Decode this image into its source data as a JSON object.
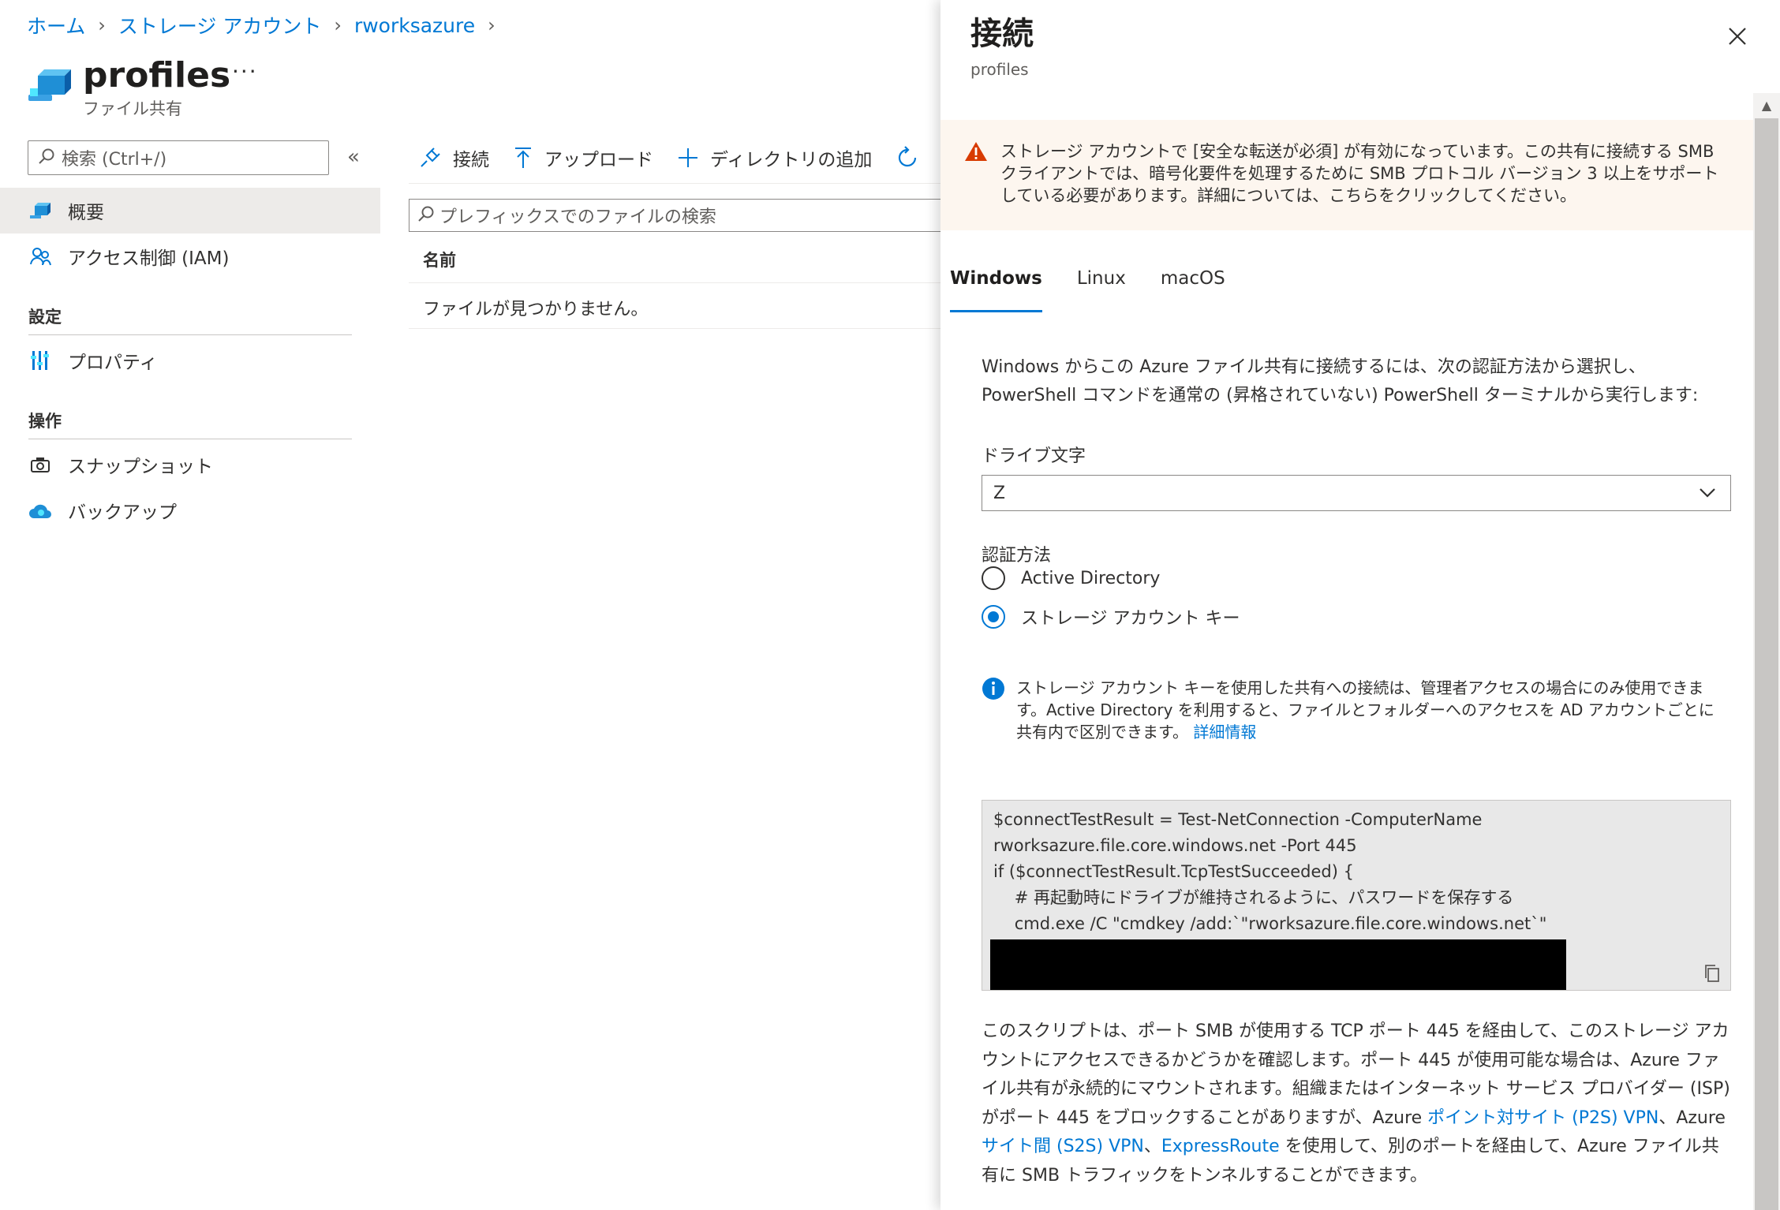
{
  "breadcrumb": {
    "items": [
      "ホーム",
      "ストレージ アカウント",
      "rworksazure"
    ]
  },
  "header": {
    "title": "profiles",
    "more": "···",
    "subtitle": "ファイル共有"
  },
  "sidebar": {
    "search_placeholder": "検索 (Ctrl+/)",
    "collapse": "«",
    "items": [
      {
        "label": "概要",
        "icon": "file-share-icon"
      },
      {
        "label": "アクセス制御 (IAM)",
        "icon": "people-icon"
      }
    ],
    "sections": [
      {
        "title": "設定",
        "items": [
          {
            "label": "プロパティ",
            "icon": "properties-icon"
          }
        ]
      },
      {
        "title": "操作",
        "items": [
          {
            "label": "スナップショット",
            "icon": "snapshot-icon"
          },
          {
            "label": "バックアップ",
            "icon": "backup-cloud-icon"
          }
        ]
      }
    ]
  },
  "toolbar": {
    "connect_label": "接続",
    "upload_label": "アップロード",
    "add_directory_label": "ディレクトリの追加"
  },
  "files": {
    "search_placeholder": "プレフィックスでのファイルの検索",
    "column_name": "名前",
    "empty_message": "ファイルが見つかりません。"
  },
  "panel": {
    "title": "接続",
    "subtitle": "profiles",
    "warning": "ストレージ アカウントで [安全な転送が必須] が有効になっています。この共有に接続する SMB クライアントでは、暗号化要件を処理するために SMB プロトコル バージョン 3 以上をサポートしている必要があります。詳細については、こちらをクリックしてください。",
    "tabs": [
      "Windows",
      "Linux",
      "macOS"
    ],
    "intro": "Windows からこの Azure ファイル共有に接続するには、次の認証方法から選択し、PowerShell コマンドを通常の (昇格されていない) PowerShell ターミナルから実行します:",
    "drive_label": "ドライブ文字",
    "drive_value": "Z",
    "auth_label": "認証方法",
    "auth_options": [
      "Active Directory",
      "ストレージ アカウント キー"
    ],
    "info_text": "ストレージ アカウント キーを使用した共有への接続は、管理者アクセスの場合にのみ使用できます。Active Directory を利用すると、ファイルとフォルダーへのアクセスを AD アカウントごとに共有内で区別できます。",
    "info_link": "詳細情報",
    "code_lines": [
      "$connectTestResult = Test-NetConnection -ComputerName",
      "rworksazure.file.core.windows.net -Port 445",
      "if ($connectTestResult.TcpTestSucceeded) {",
      "    # 再起動時にドライブが維持されるように、パスワードを保存する",
      "    cmd.exe /C \"cmdkey /add:`\"rworksazure.file.core.windows.net`\""
    ],
    "desc_part1": "このスクリプトは、ポート SMB が使用する TCP ポート 445 を経由して、このストレージ アカウントにアクセスできるかどうかを確認します。ポート 445 が使用可能な場合は、Azure ファイル共有が永続的にマウントされます。組織またはインターネット サービス プロバイダー (ISP) がポート 445 をブロックすることがありますが、Azure ",
    "desc_link1": "ポイント対サイト (P2S) VPN",
    "desc_part2": "、Azure ",
    "desc_link2": "サイト間 (S2S) VPN",
    "desc_part3": "、",
    "desc_link3": "ExpressRoute",
    "desc_part4": " を使用して、別のポートを経由して、Azure ファイル共有に SMB トラフィックをトンネルすることができます。"
  },
  "colors": {
    "accent": "#0078d4",
    "warning": "#d83b01",
    "warning_bg": "#fdf6ef"
  }
}
